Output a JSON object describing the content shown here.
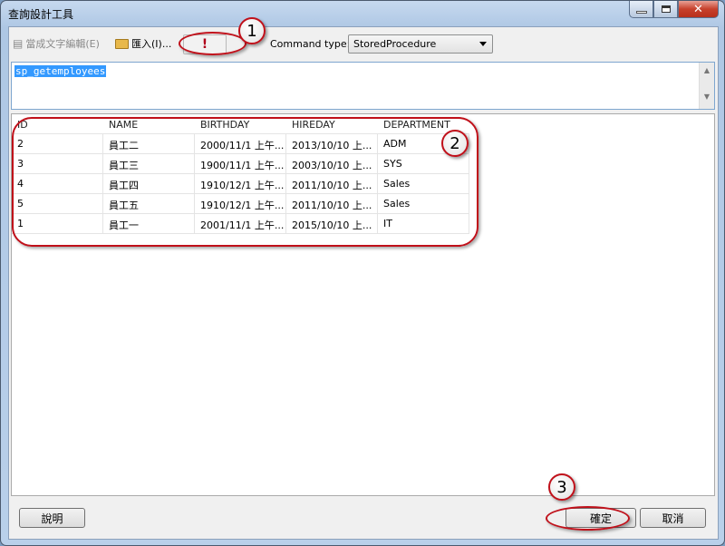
{
  "window": {
    "title": "查詢設計工具",
    "min_icon": "minimize-icon",
    "max_icon": "maximize-icon",
    "close_icon": "close-icon"
  },
  "toolbar": {
    "edit_as_text": "當成文字編輯(E)",
    "import": "匯入(I)...",
    "run": "!",
    "command_type_label": "Command type:",
    "command_type_value": "StoredProcedure"
  },
  "query": {
    "text": "sp_getemployees"
  },
  "grid": {
    "columns": [
      "ID",
      "NAME",
      "BIRTHDAY",
      "HIREDAY",
      "DEPARTMENT"
    ],
    "rows": [
      [
        "2",
        "員工二",
        "2000/11/1 上午...",
        "2013/10/10 上...",
        "ADM"
      ],
      [
        "3",
        "員工三",
        "1900/11/1 上午...",
        "2003/10/10 上...",
        "SYS"
      ],
      [
        "4",
        "員工四",
        "1910/12/1 上午...",
        "2011/10/10 上...",
        "Sales"
      ],
      [
        "5",
        "員工五",
        "1910/12/1 上午...",
        "2011/10/10 上...",
        "Sales"
      ],
      [
        "1",
        "員工一",
        "2001/11/1 上午...",
        "2015/10/10 上...",
        "IT"
      ]
    ]
  },
  "buttons": {
    "help": "說明",
    "ok": "確定",
    "cancel": "取消"
  },
  "annotations": [
    "1",
    "2",
    "3"
  ],
  "colors": {
    "annotation": "#c0101a",
    "selection": "#3399ff"
  }
}
